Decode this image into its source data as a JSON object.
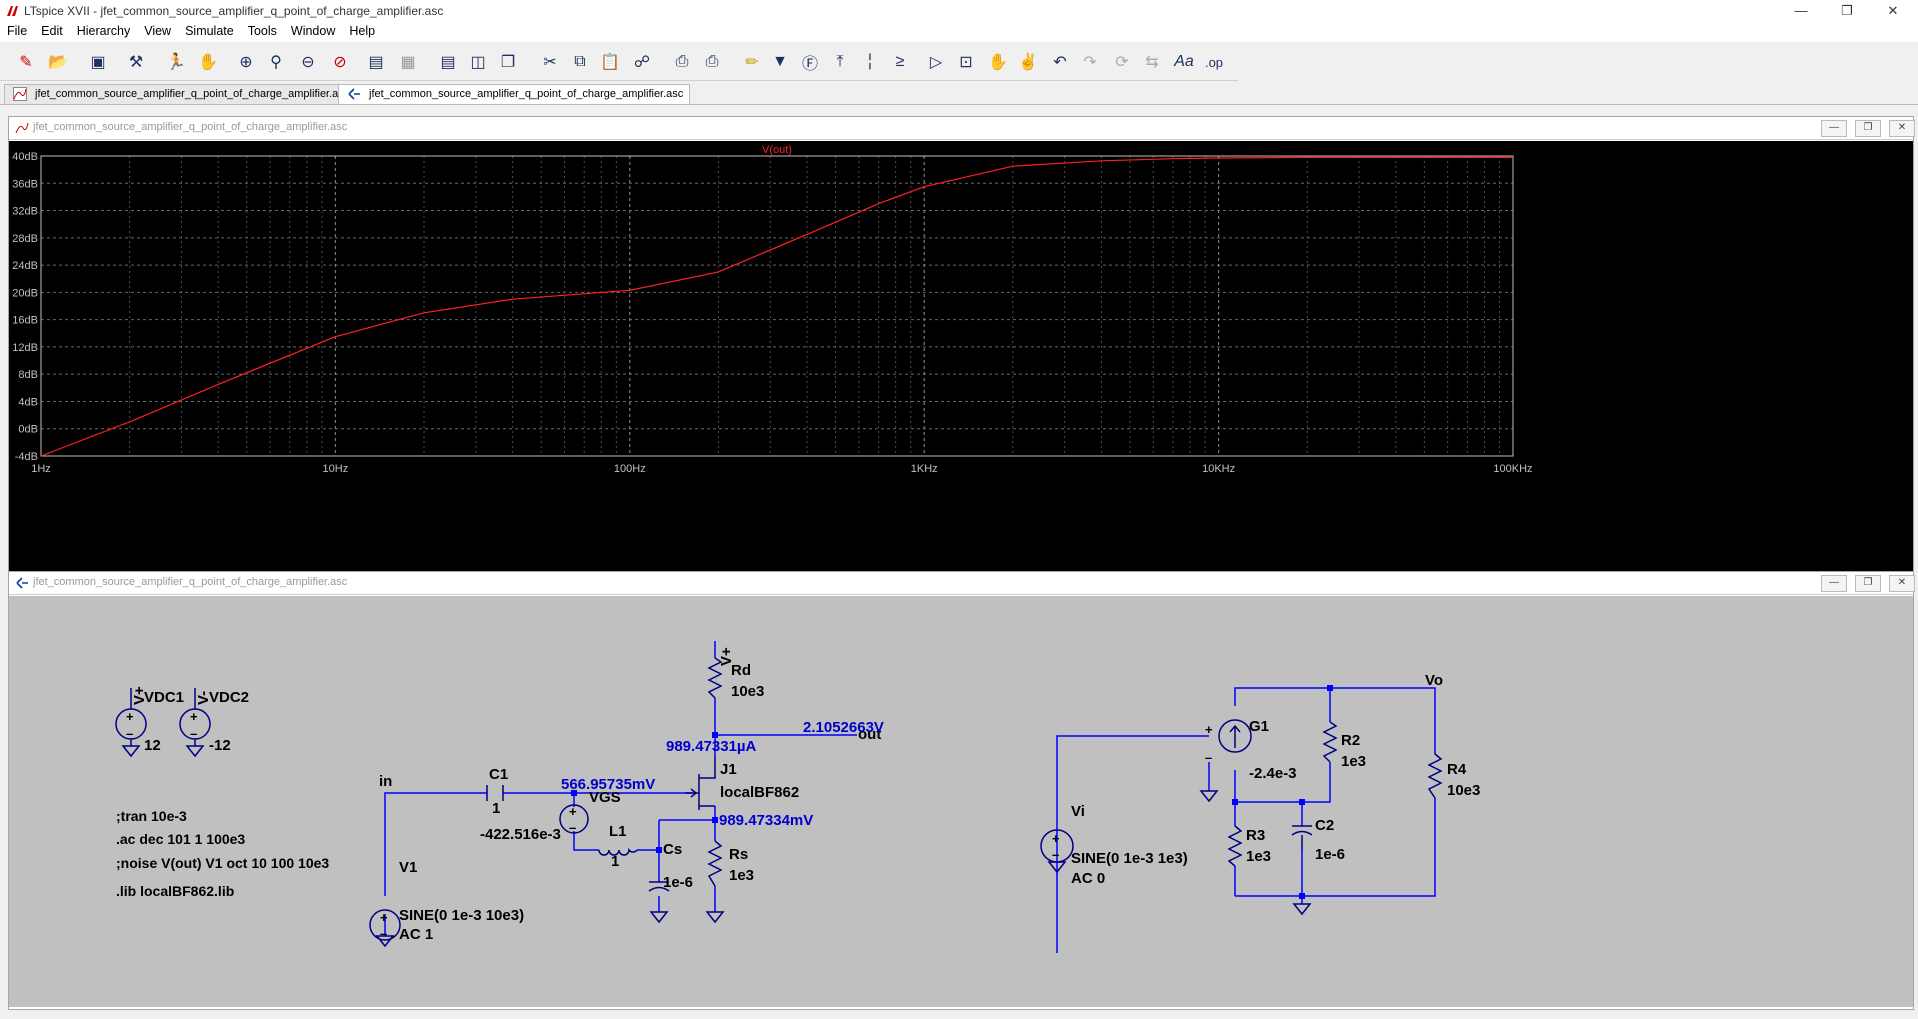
{
  "window": {
    "title": "LTspice XVII - jfet_common_source_amplifier_q_point_of_charge_amplifier.asc",
    "minimize_icon": "minimize-icon",
    "restore_icon": "restore-icon",
    "close_icon": "close-icon"
  },
  "menu": [
    "File",
    "Edit",
    "Hierarchy",
    "View",
    "Simulate",
    "Tools",
    "Window",
    "Help"
  ],
  "toolbar_icons": [
    "new-schematic-icon",
    "open-icon",
    "save-icon",
    "control-panel-icon",
    "run-icon",
    "halt-icon",
    "zoom-in-icon",
    "zoom-area-icon",
    "zoom-out-icon",
    "zoom-fit-icon",
    "autorange-icon",
    "mark-units-icon",
    "tile-horizontal-icon",
    "tile-vertical-icon",
    "cascade-icon",
    "cut-icon",
    "copy-icon",
    "paste-icon",
    "find-icon",
    "print-setup-icon",
    "print-icon",
    "draw-wire-icon",
    "ground-icon",
    "label-net-icon",
    "resistor-icon",
    "capacitor-icon",
    "inductor-icon",
    "diode-icon",
    "component-icon",
    "move-icon",
    "drag-icon",
    "undo-icon",
    "redo-icon",
    "rotate-icon",
    "mirror-icon",
    "text-icon",
    "spice-directive-icon"
  ],
  "tabs": [
    {
      "label": "jfet_common_source_amplifier_q_point_of_charge_amplifier.asc",
      "icon": "waveform-icon",
      "active": false
    },
    {
      "label": "jfet_common_source_amplifier_q_point_of_charge_amplifier.asc",
      "icon": "schematic-icon",
      "active": true
    }
  ],
  "plot_window": {
    "title": "jfet_common_source_amplifier_q_point_of_charge_amplifier.asc"
  },
  "schematic_window": {
    "title": "jfet_common_source_amplifier_q_point_of_charge_amplifier.asc"
  },
  "chart_data": {
    "type": "line",
    "title": "V(out)",
    "xscale": "log",
    "xlim": [
      1,
      100000
    ],
    "ylim": [
      -4,
      40
    ],
    "x_ticks": [
      "1Hz",
      "10Hz",
      "100Hz",
      "1KHz",
      "10KHz",
      "100KHz"
    ],
    "y_ticks": [
      "40dB",
      "36dB",
      "32dB",
      "28dB",
      "24dB",
      "20dB",
      "16dB",
      "12dB",
      "8dB",
      "4dB",
      "0dB",
      "-4dB"
    ],
    "grid": true,
    "colors": {
      "background": "#000000",
      "trace": "#ff2020",
      "grid": "#808080",
      "text": "#c0c0c0"
    },
    "series": [
      {
        "name": "V(out)",
        "x": [
          1,
          2,
          4,
          10,
          20,
          40,
          100,
          200,
          400,
          700,
          1000,
          2000,
          4000,
          7000,
          10000,
          20000,
          100000
        ],
        "y": [
          -4,
          1,
          6.5,
          13.5,
          17,
          19,
          20.3,
          23,
          28.5,
          33,
          35.5,
          38.5,
          39.3,
          39.6,
          39.7,
          39.8,
          39.8
        ]
      }
    ]
  },
  "schematic": {
    "colors": {
      "wire": "#0000ff",
      "component": "#000080",
      "text": "#000000",
      "annotation": "#0000cc",
      "background": "#c0c0c0"
    },
    "labels": {
      "vplus_top": "V+",
      "rd": "Rd",
      "rd_val": "10e3",
      "op_vout": "2.1052663V",
      "out": "out",
      "op_id": "989.47331µA",
      "j1": "J1",
      "j1_model": "localBF862",
      "op_vs": "989.47334mV",
      "in": "in",
      "c1": "C1",
      "c1_val": "1",
      "op_vg": "566.95735mV",
      "vgs": "VGS",
      "vgs_val": "-422.516e-3",
      "l1": "L1",
      "l1_val": "1",
      "cs": "Cs",
      "cs_val": "1e-6",
      "rs": "Rs",
      "rs_val": "1e3",
      "v1": "V1",
      "v1_src": "SINE(0 1e-3 10e3)",
      "v1_ac": "AC 1",
      "vdc1_lbl": "V+",
      "vdc1": "VDC1",
      "vdc1_val": "12",
      "vdc2_lbl": "V-",
      "vdc2": "VDC2",
      "vdc2_val": "-12",
      "vo": "Vo",
      "g1": "G1",
      "g1_val": "-2.4e-3",
      "r2": "R2",
      "r2_val": "1e3",
      "r4": "R4",
      "r4_val": "10e3",
      "vi": "Vi",
      "vi_src": "SINE(0 1e-3 1e3)",
      "vi_ac": "AC 0",
      "r3": "R3",
      "r3_val": "1e3",
      "c2": "C2",
      "c2_val": "1e-6"
    },
    "directives": [
      ";tran 10e-3",
      ".ac dec 101 1 100e3",
      ";noise V(out) V1 oct 10 100 10e3",
      ".lib localBF862.lib"
    ]
  }
}
